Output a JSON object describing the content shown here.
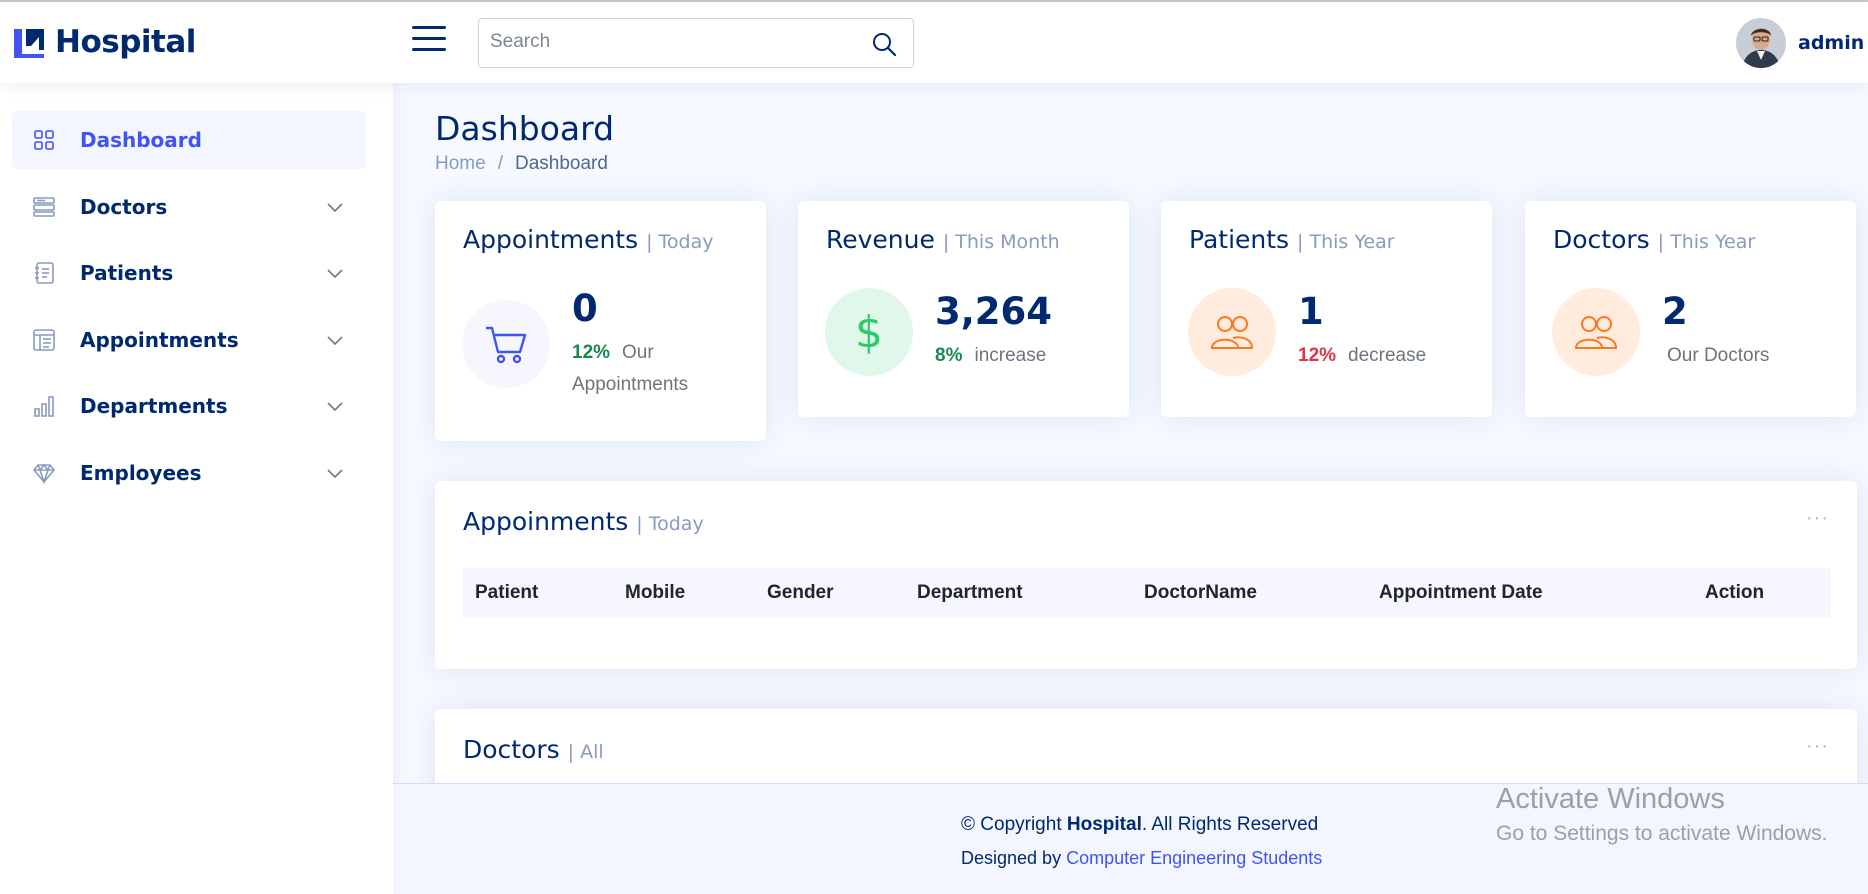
{
  "header": {
    "app_name": "Hospital",
    "search_placeholder": "Search",
    "user_name": "admin"
  },
  "sidebar": {
    "items": [
      {
        "label": "Dashboard",
        "icon": "grid-icon",
        "active": true
      },
      {
        "label": "Doctors",
        "icon": "menu-list-icon"
      },
      {
        "label": "Patients",
        "icon": "journal-text-icon"
      },
      {
        "label": "Appointments",
        "icon": "layout-text-icon"
      },
      {
        "label": "Departments",
        "icon": "bar-chart-icon"
      },
      {
        "label": "Employees",
        "icon": "gem-icon"
      }
    ]
  },
  "page": {
    "title": "Dashboard",
    "breadcrumb": [
      "Home",
      "/",
      "Dashboard"
    ]
  },
  "stats": [
    {
      "title": "Appointments",
      "period": "| Today",
      "value": "0",
      "pct": "12%",
      "text": "Our Appointments",
      "pct_color": "#198754",
      "icon": "cart-icon"
    },
    {
      "title": "Revenue",
      "period": "| This Month",
      "value": "3,264",
      "pct": "8%",
      "text": "increase",
      "pct_color": "#198754",
      "icon": "dollar-icon"
    },
    {
      "title": "Patients",
      "period": "| This Year",
      "value": "1",
      "pct": "12%",
      "text": "decrease",
      "pct_color": "#dc3545",
      "icon": "people-icon"
    },
    {
      "title": "Doctors",
      "period": "| This Year",
      "value": "2",
      "pct": "",
      "text": "Our Doctors",
      "icon": "people-icon"
    }
  ],
  "appointments_card": {
    "title": "Appoinments",
    "period": "| Today",
    "menu": "···",
    "columns": [
      "Patient",
      "Mobile",
      "Gender",
      "Department",
      "DoctorName",
      "Appointment Date",
      "Action"
    ]
  },
  "doctors_card": {
    "title": "Doctors",
    "period": "| All",
    "menu": "···"
  },
  "footer": {
    "copyright_prefix": "© Copyright",
    "brand": "Hospital",
    "copyright_suffix": ". All Rights Reserved",
    "designed_by": "Designed by",
    "designer": "Computer Engineering Students"
  },
  "watermark": {
    "line1": "Activate Windows",
    "line2": "Go to Settings to activate Windows."
  },
  "colors": {
    "brand": "#012970",
    "accent": "#4154f1",
    "green": "#198754",
    "red": "#dc3545",
    "orange": "#ff771d"
  }
}
